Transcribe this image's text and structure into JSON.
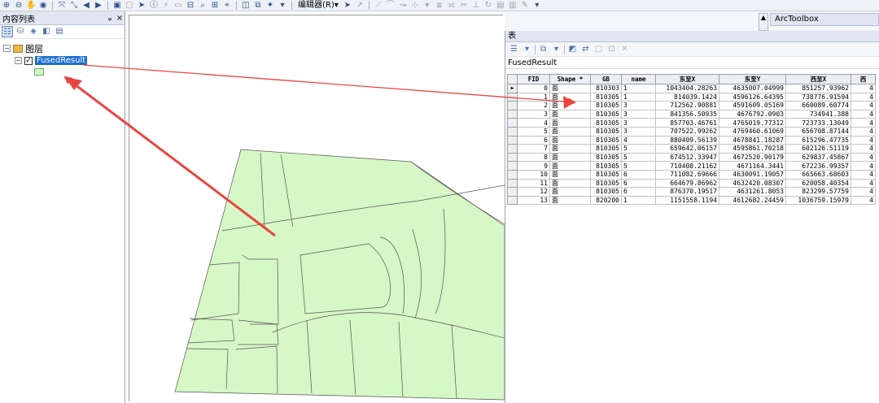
{
  "toolbar": {
    "editor_menu": "编辑器(R)▾"
  },
  "toc": {
    "title": "内容列表",
    "pin": "ᵩ",
    "close": "×",
    "layers_group": "图层",
    "layer_name": "FusedResult"
  },
  "arctoolbox": {
    "title": "ArcToolbox"
  },
  "table": {
    "window_title": "表",
    "tab_name": "FusedResult",
    "columns": [
      "FID",
      "Shape *",
      "GB",
      "name",
      "东至X",
      "东至Y",
      "西至X",
      "西"
    ],
    "rows": [
      [
        "0",
        "面",
        "810303",
        "1",
        "1043404.28263",
        "4635007.04999",
        "851257.93962",
        "4"
      ],
      [
        "1",
        "面",
        "810305",
        "1",
        "814039.1424",
        "4596126.64395",
        "738776.91594",
        "4"
      ],
      [
        "2",
        "面",
        "810305",
        "3",
        "712562.90881",
        "4591609.05169",
        "660089.60774",
        "4"
      ],
      [
        "3",
        "面",
        "810305",
        "3",
        "841356.50935",
        "4676792.0903",
        "734941.388",
        "4"
      ],
      [
        "4",
        "面",
        "810305",
        "3",
        "857703.46761",
        "4765019.77312",
        "723733.13049",
        "4"
      ],
      [
        "5",
        "面",
        "810305",
        "3",
        "707522.99262",
        "4769460.61069",
        "656708.87144",
        "4"
      ],
      [
        "6",
        "面",
        "810305",
        "4",
        "880409.56139",
        "4678841.18287",
        "615296.47735",
        "4"
      ],
      [
        "7",
        "面",
        "810305",
        "5",
        "659642.06157",
        "4595861.70218",
        "602126.51119",
        "4"
      ],
      [
        "8",
        "面",
        "810305",
        "5",
        "674512.33947",
        "4672520.90179",
        "629837.45867",
        "4"
      ],
      [
        "9",
        "面",
        "810305",
        "5",
        "710408.21162",
        "4671164.3441",
        "672236.99357",
        "4"
      ],
      [
        "10",
        "面",
        "810305",
        "6",
        "711082.69666",
        "4630091.19057",
        "665663.68603",
        "4"
      ],
      [
        "11",
        "面",
        "810305",
        "6",
        "664679.86962",
        "4632420.08307",
        "620058.40354",
        "4"
      ],
      [
        "12",
        "面",
        "810305",
        "6",
        "876370.19517",
        "4631261.8053",
        "823299.57759",
        "4"
      ],
      [
        "13",
        "面",
        "820200",
        "1",
        "1151558.1194",
        "4612682.24459",
        "1036759.15979",
        "4"
      ]
    ]
  },
  "colors": {
    "polygon_fill": "#d6f7c6",
    "annotation_arrow": "#e8463f",
    "selection_blue": "#1c6fd1"
  }
}
